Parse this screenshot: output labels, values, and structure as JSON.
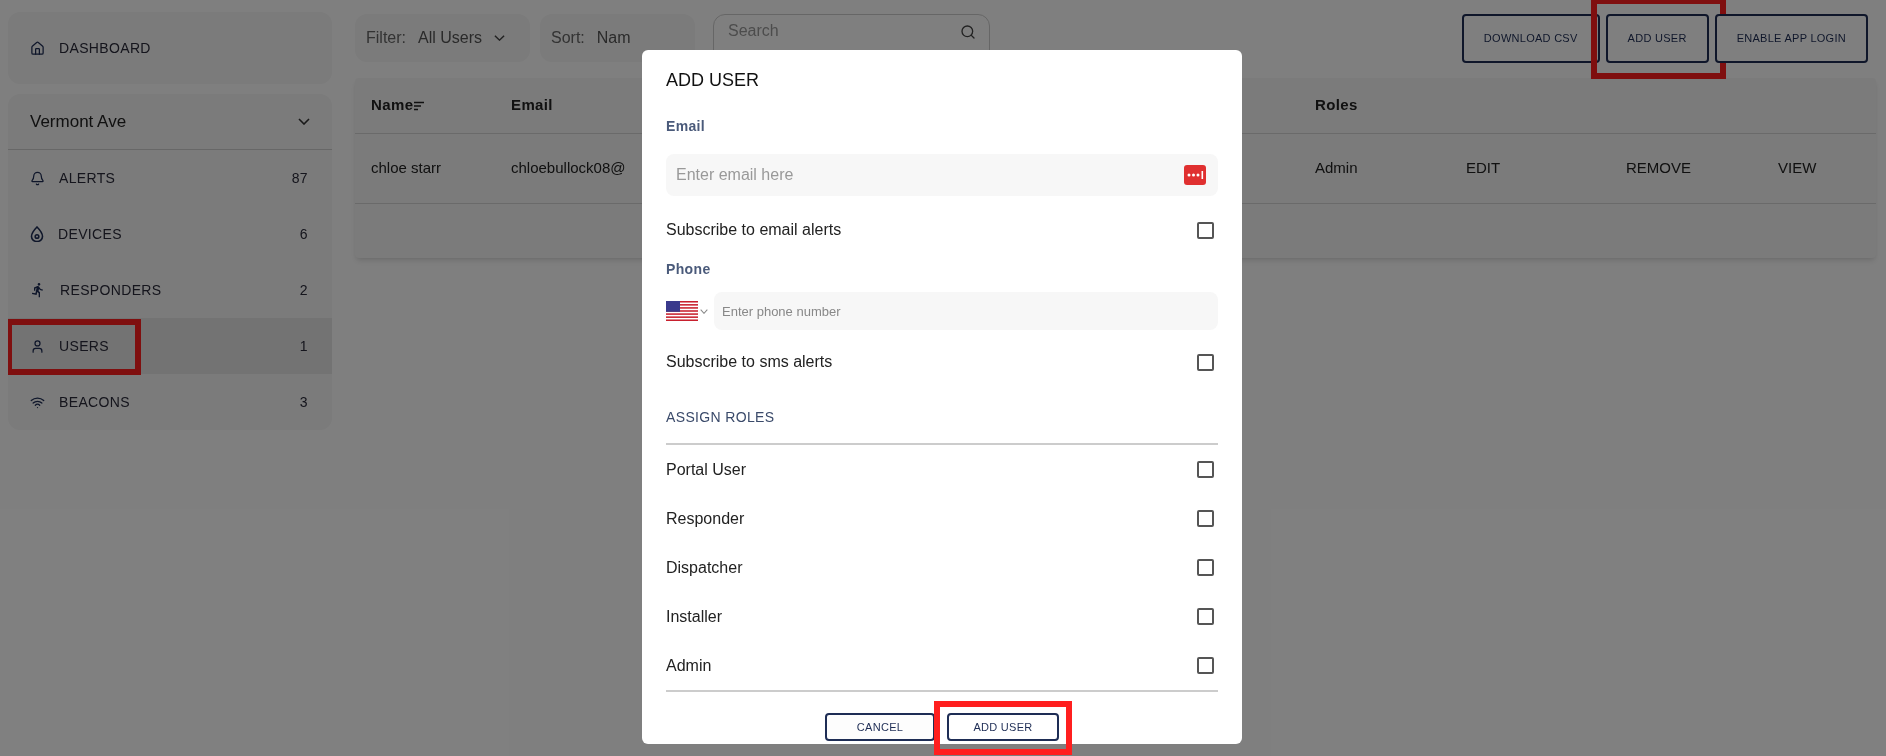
{
  "sidebar": {
    "dashboard": {
      "label": "DASHBOARD"
    },
    "venue": {
      "label": "Vermont Ave"
    },
    "items": [
      {
        "label": "ALERTS",
        "count": "87",
        "selected": false,
        "highlighted": false
      },
      {
        "label": "DEVICES",
        "count": "6",
        "selected": false,
        "highlighted": false
      },
      {
        "label": "RESPONDERS",
        "count": "2",
        "selected": false,
        "highlighted": false
      },
      {
        "label": "USERS",
        "count": "1",
        "selected": true,
        "highlighted": true
      },
      {
        "label": "BEACONS",
        "count": "3",
        "selected": false,
        "highlighted": false
      }
    ]
  },
  "toolbar": {
    "filter": {
      "label": "Filter:",
      "value": "All Users"
    },
    "sort": {
      "label": "Sort:",
      "value": "Nam"
    },
    "search": {
      "placeholder": "Search"
    },
    "buttons": [
      {
        "label": "DOWNLOAD CSV",
        "highlighted": false
      },
      {
        "label": "ADD USER",
        "highlighted": true
      },
      {
        "label": "ENABLE APP LOGIN",
        "highlighted": false
      }
    ]
  },
  "table": {
    "columns": [
      "Name",
      "Email",
      "Roles"
    ],
    "rows": [
      {
        "name": "chloe starr",
        "email": "chloebullock08@",
        "roles": "Admin",
        "actions": [
          "EDIT",
          "REMOVE",
          "VIEW"
        ]
      }
    ]
  },
  "modal": {
    "title": "ADD USER",
    "email_label": "Email",
    "email_placeholder": "Enter email here",
    "email_subscribe": {
      "label": "Subscribe to email alerts",
      "checked": false
    },
    "phone_label": "Phone",
    "phone_placeholder": "Enter phone number",
    "sms_subscribe": {
      "label": "Subscribe to sms alerts",
      "checked": false
    },
    "roles_heading": "ASSIGN ROLES",
    "roles": [
      {
        "label": "Portal User",
        "checked": false
      },
      {
        "label": "Responder",
        "checked": false
      },
      {
        "label": "Dispatcher",
        "checked": false
      },
      {
        "label": "Installer",
        "checked": false
      },
      {
        "label": "Admin",
        "checked": false
      }
    ],
    "buttons": [
      {
        "kind": "secondary",
        "label": "CANCEL",
        "highlighted": false
      },
      {
        "kind": "primary",
        "label": "ADD USER",
        "highlighted": true
      }
    ]
  }
}
